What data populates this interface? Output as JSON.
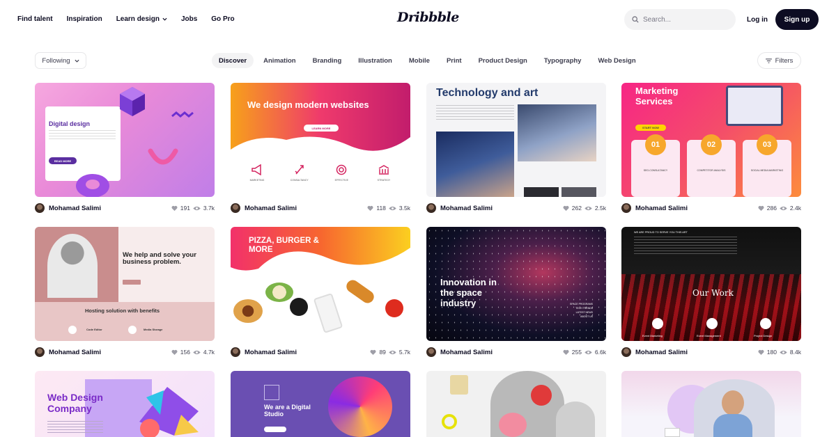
{
  "nav": {
    "links": [
      "Find talent",
      "Inspiration",
      "Learn design",
      "Jobs",
      "Go Pro"
    ],
    "logo": "Dribbble",
    "search_placeholder": "Search...",
    "login": "Log in",
    "signup": "Sign up"
  },
  "filterbar": {
    "following": "Following",
    "categories": [
      "Discover",
      "Animation",
      "Branding",
      "Illustration",
      "Mobile",
      "Print",
      "Product Design",
      "Typography",
      "Web Design"
    ],
    "active_category": "Discover",
    "filters": "Filters"
  },
  "shots": [
    {
      "author": "Mohamad Salimi",
      "likes": "191",
      "views": "3.7k",
      "thumb": {
        "title": "Digital design",
        "button": "READ MORE"
      }
    },
    {
      "author": "Mohamad Salimi",
      "likes": "118",
      "views": "3.5k",
      "thumb": {
        "title": "We design modern websites",
        "button": "LEARN MORE",
        "icons": [
          "MARKETING",
          "CONSULTANCY",
          "EFFECTIVE",
          "STRATEGY"
        ]
      }
    },
    {
      "author": "Mohamad Salimi",
      "likes": "262",
      "views": "2.5k",
      "thumb": {
        "title": "Technology and art"
      }
    },
    {
      "author": "Mohamad Salimi",
      "likes": "286",
      "views": "2.4k",
      "thumb": {
        "title": "Marketing Services",
        "button": "START NOW",
        "steps": [
          "01",
          "02",
          "03"
        ],
        "step_labels": [
          "SEO-CONSULTANCY",
          "COMPETITOR ANALYSIS",
          "SOCIAL MEDIA MARKETING"
        ]
      }
    },
    {
      "author": "Mohamad Salimi",
      "likes": "156",
      "views": "4.7k",
      "thumb": {
        "title": "We help and solve your business problem.",
        "subtitle": "Hosting solution with benefits",
        "items": [
          "Code Editor",
          "Media Storage"
        ]
      }
    },
    {
      "author": "Mohamad Salimi",
      "likes": "89",
      "views": "5.7k",
      "thumb": {
        "title": "PIZZA, BURGER & MORE"
      }
    },
    {
      "author": "Mohamad Salimi",
      "likes": "255",
      "views": "6.6k",
      "thumb": {
        "title": "Innovation in the space industry",
        "menu": [
          "SPACE PROGRAMS",
          "TECH TRENDS",
          "LATEST NEWS",
          "ABOUT US"
        ]
      }
    },
    {
      "author": "Mohamad Salimi",
      "likes": "180",
      "views": "8.4k",
      "thumb": {
        "title": "Our Work",
        "tagline": "WE ARE PROUD TO SERVE YOU THIS ART",
        "items": [
          "Event Marketing",
          "Event Management",
          "Project Design"
        ]
      }
    },
    {
      "thumb": {
        "title": "Web Design Company"
      }
    },
    {
      "thumb": {
        "title": "We are a Digital Studio"
      }
    },
    {
      "thumb": {}
    },
    {
      "thumb": {}
    }
  ]
}
